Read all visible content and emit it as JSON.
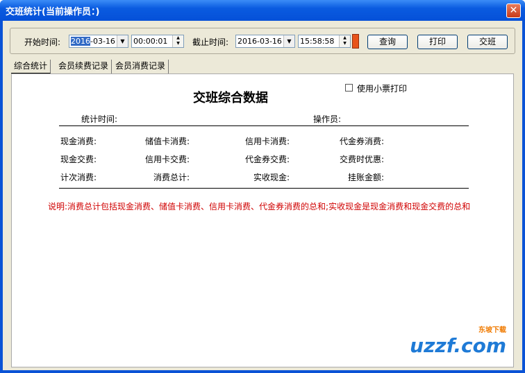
{
  "window": {
    "title": "交班统计(当前操作员：)"
  },
  "filters": {
    "start_label": "开始时间:",
    "start_date": "2016-03-16",
    "start_date_sel": "2016",
    "start_date_rest": "-03-16",
    "start_time": "00:00:01",
    "end_label": "截止时间:",
    "end_date": "2016-03-16",
    "end_time": "15:58:58"
  },
  "buttons": {
    "query": "查询",
    "print": "打印",
    "handover": "交班"
  },
  "tabs": [
    "综合统计",
    "会员续费记录",
    "会员消费记录"
  ],
  "panel": {
    "heading": "交班综合数据",
    "receipt_print": "使用小票打印",
    "stat_time": "统计时间:",
    "operator": "操作员:",
    "rows": [
      [
        "现金消费:",
        "储值卡消费:",
        "信用卡消费:",
        "代金券消费:"
      ],
      [
        "现金交费:",
        "信用卡交费:",
        "代金券交费:",
        "交费时优惠:"
      ],
      [
        "计次消费:",
        "消费总计:",
        "实收现金:",
        "挂账金额:"
      ]
    ],
    "note": "说明:消费总计包括现金消费、储值卡消费、信用卡消费、代金券消费的总和;实收现金是现金消费和现金交费的总和"
  },
  "watermark": {
    "brand": "uzzf.com",
    "tag": "东坡下载"
  }
}
